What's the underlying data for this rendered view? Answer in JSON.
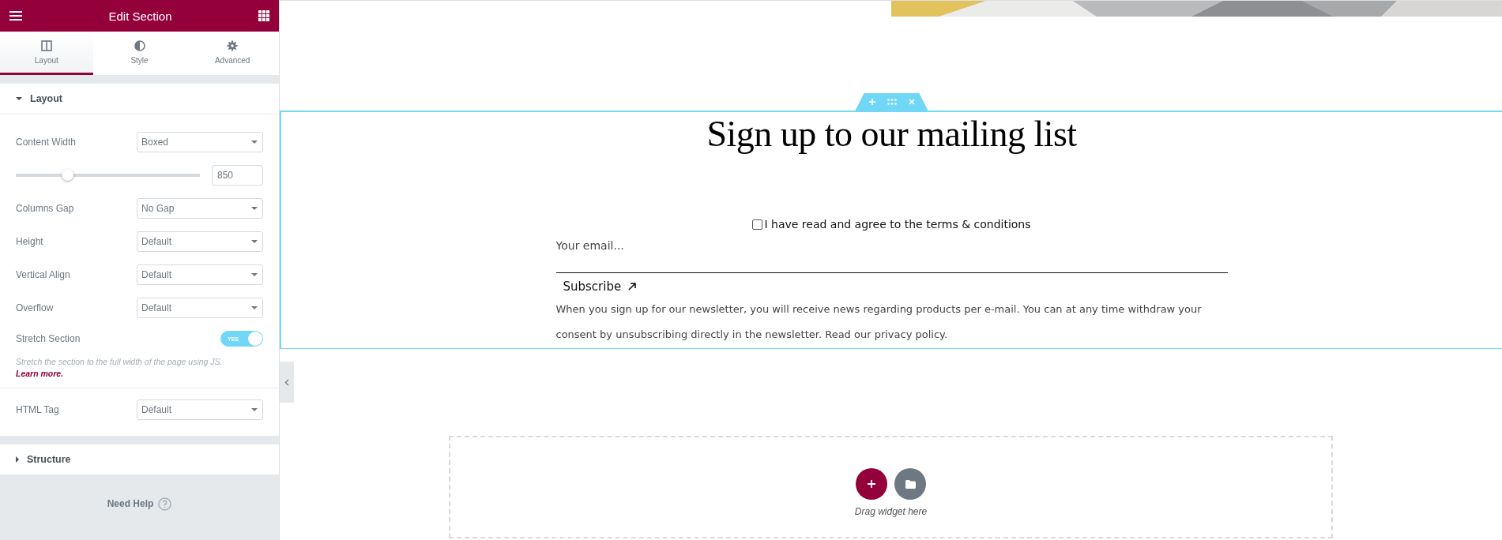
{
  "panel": {
    "title": "Edit Section",
    "tabs": [
      {
        "label": "Layout",
        "selected": true
      },
      {
        "label": "Style",
        "selected": false
      },
      {
        "label": "Advanced",
        "selected": false
      }
    ],
    "layout_section": {
      "title": "Layout",
      "expanded": true,
      "controls": [
        {
          "kind": "select",
          "label": "Content Width",
          "value": "Boxed"
        },
        {
          "kind": "slider",
          "level": 0.28,
          "value": "850"
        },
        {
          "kind": "select",
          "label": "Columns Gap",
          "value": "No Gap"
        },
        {
          "kind": "select",
          "label": "Height",
          "value": "Default"
        },
        {
          "kind": "select",
          "label": "Vertical Align",
          "value": "Default"
        },
        {
          "kind": "select",
          "label": "Overflow",
          "value": "Default"
        },
        {
          "kind": "switch",
          "label": "Stretch Section",
          "on": true,
          "state_text": "YES"
        },
        {
          "kind": "hint",
          "text": "Stretch the section to the full width of the page using JS.",
          "link": "Learn more."
        },
        {
          "kind": "divider"
        },
        {
          "kind": "select",
          "label": "HTML Tag",
          "value": "Default"
        }
      ]
    },
    "structure_section": {
      "title": "Structure",
      "expanded": false
    },
    "help": "Need Help"
  },
  "canvas": {
    "heading": "Sign up to our mailing list",
    "terms": {
      "label": "I have read and agree to the terms & conditions",
      "checked": false
    },
    "email": {
      "placeholder": "Your email..."
    },
    "subscribe": "Subscribe",
    "disclaimer": "When you sign up for our newsletter, you will receive news regarding products per e-mail. You can at any time withdraw your consent by unsubscribing directly in the newsletter. Read our privacy policy.",
    "drop_zone": {
      "text": "Drag widget here"
    }
  }
}
